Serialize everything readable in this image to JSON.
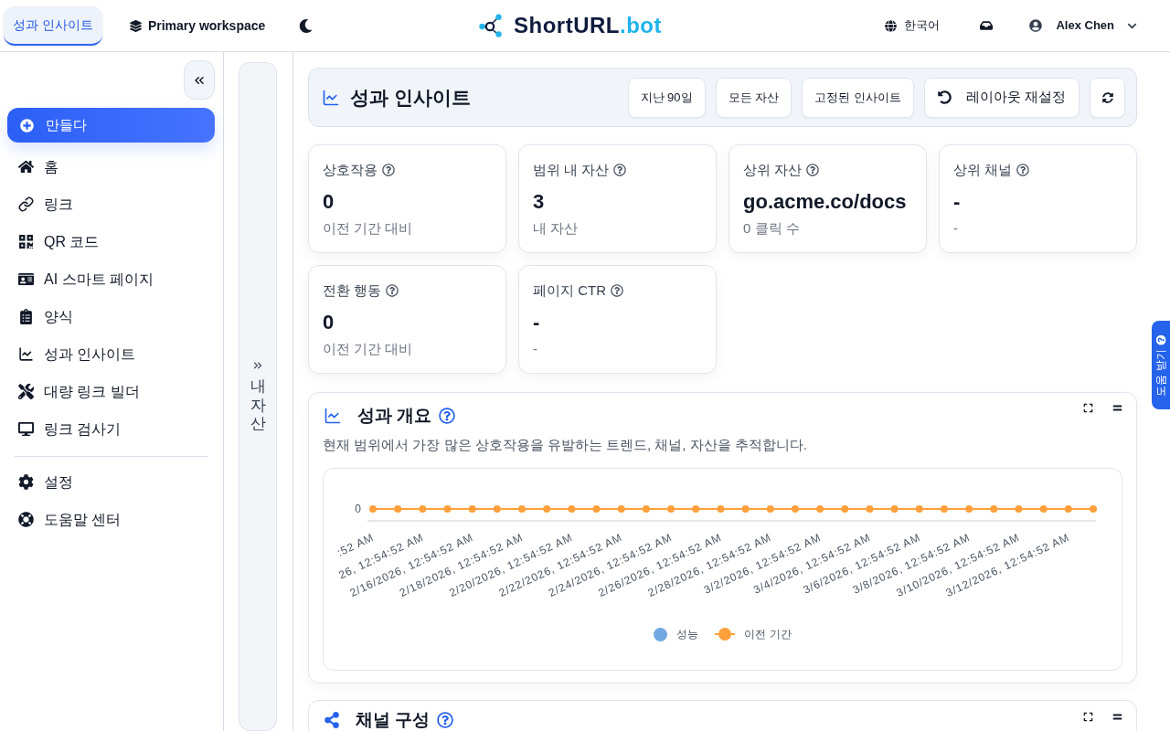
{
  "top_bar": {
    "tab": {
      "label": "성과 인사이트",
      "selected": true
    },
    "workspace": "Primary workspace",
    "logo": {
      "name": "ShortURL",
      "suffix": ".bot"
    },
    "language": "한국어",
    "user": "Alex Chen"
  },
  "sidebar": {
    "create_button": "만들다",
    "items": [
      "홈",
      "링크",
      "QR 코드",
      "AI 스마트 페이지",
      "양식",
      "성과 인사이트",
      "대량 링크 빌더",
      "링크 검사기"
    ],
    "footer_items": [
      "설정",
      "도움말 센터"
    ]
  },
  "assets_panel": {
    "label": "내 자산"
  },
  "page_header": {
    "title": "성과 인사이트",
    "filters": [
      "지난 90일",
      "모든 자산",
      "고정된 인사이트"
    ],
    "reset_button": "레이아웃 재설정"
  },
  "stats": [
    {
      "label": "상호작용",
      "value": "0",
      "note": "이전 기간 대비"
    },
    {
      "label": "범위 내 자산",
      "value": "3",
      "note": "내 자산"
    },
    {
      "label": "상위 자산",
      "value": "go.acme.co/docs",
      "note": "0 클릭 수"
    },
    {
      "label": "상위 채널",
      "value": "-",
      "note": "-"
    },
    {
      "label": "전환 행동",
      "value": "0",
      "note": "이전 기간 대비"
    },
    {
      "label": "페이지 CTR",
      "value": "-",
      "note": "-"
    }
  ],
  "overview": {
    "title": "성과 개요",
    "description": "현재 범위에서 가장 많은 상호작용을 유발하는 트렌드, 채널, 자산을 추적합니다.",
    "trend_chart": {
      "y_tick_labels": [
        "0"
      ],
      "x_tick_labels": [
        ":52 AM",
        "26, 12:54:52 AM",
        "2/16/2026, 12:54:52 AM",
        "2/18/2026, 12:54:52 AM",
        "2/20/2026, 12:54:52 AM",
        "2/22/2026, 12:54:52 AM",
        "2/24/2026, 12:54:52 AM",
        "2/26/2026, 12:54:52 AM",
        "2/28/2026, 12:54:52 AM",
        "3/2/2026, 12:54:52 AM",
        "3/4/2026, 12:54:52 AM",
        "3/6/2026, 12:54:52 AM",
        "3/8/2026, 12:54:52 AM",
        "3/10/2026, 12:54:52 AM",
        "3/12/2026, 12:54:52 AM"
      ],
      "legend": [
        {
          "kind": "dot",
          "name": "성능",
          "color": "#73a7e1"
        },
        {
          "kind": "line",
          "name": "이전 기간",
          "color": "#ffa03c"
        }
      ]
    }
  },
  "channel_card": {
    "title": "채널 구성"
  },
  "help_tab": {
    "label": "도움 받기"
  }
}
